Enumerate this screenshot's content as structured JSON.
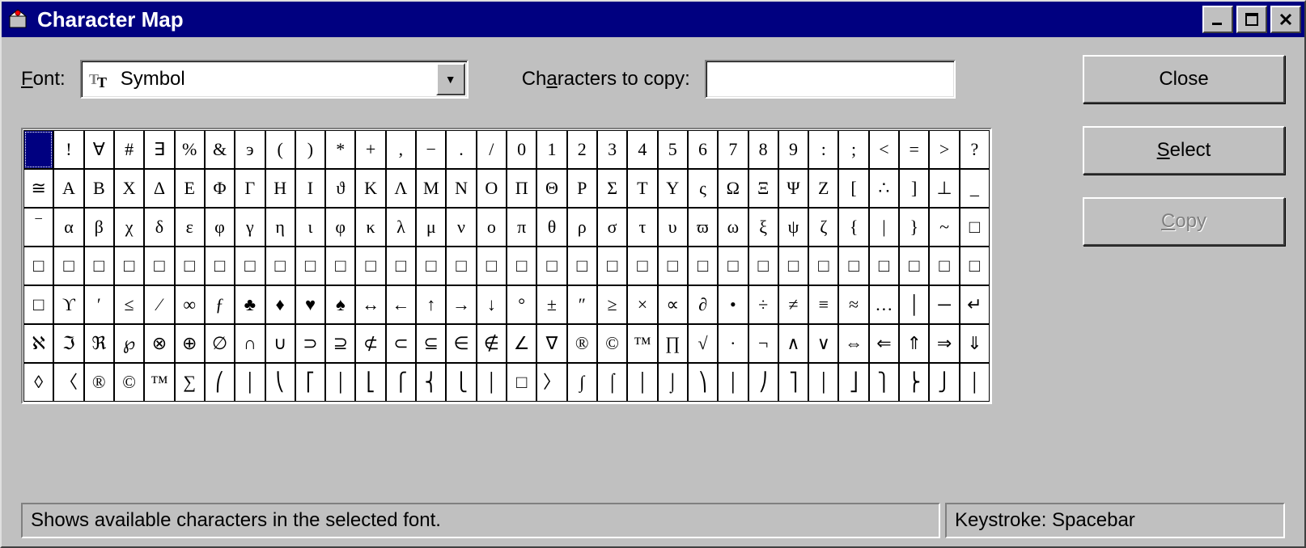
{
  "window": {
    "title": "Character Map"
  },
  "labels": {
    "font": "Font:",
    "chars_to_copy": "Characters to copy:"
  },
  "font_combo": {
    "value": "Symbol",
    "tt_glyph": "Tᴛ"
  },
  "copy_field": {
    "value": ""
  },
  "buttons": {
    "close": "Close",
    "select": "Select",
    "copy": "Copy"
  },
  "status": {
    "main": "Shows available characters in the selected font.",
    "keystroke": "Keystroke: Spacebar"
  },
  "grid": {
    "selected_index": 0,
    "rows": [
      [
        " ",
        "!",
        "∀",
        "#",
        "∃",
        "%",
        "&",
        "э",
        "(",
        ")",
        "*",
        "+",
        ",",
        "−",
        ".",
        "/",
        "0",
        "1",
        "2",
        "3",
        "4",
        "5",
        "6",
        "7",
        "8",
        "9",
        ":",
        ";",
        "<",
        "=",
        ">",
        "?"
      ],
      [
        "≅",
        "Α",
        "Β",
        "Χ",
        "Δ",
        "Ε",
        "Φ",
        "Γ",
        "Η",
        "Ι",
        "ϑ",
        "Κ",
        "Λ",
        "Μ",
        "Ν",
        "Ο",
        "Π",
        "Θ",
        "Ρ",
        "Σ",
        "Τ",
        "Υ",
        "ς",
        "Ω",
        "Ξ",
        "Ψ",
        "Ζ",
        "[",
        "∴",
        "]",
        "⊥",
        "_"
      ],
      [
        "‾",
        "α",
        "β",
        "χ",
        "δ",
        "ε",
        "φ",
        "γ",
        "η",
        "ι",
        "φ",
        "κ",
        "λ",
        "μ",
        "ν",
        "ο",
        "π",
        "θ",
        "ρ",
        "σ",
        "τ",
        "υ",
        "ϖ",
        "ω",
        "ξ",
        "ψ",
        "ζ",
        "{",
        "|",
        "}",
        "~",
        "□"
      ],
      [
        "□",
        "□",
        "□",
        "□",
        "□",
        "□",
        "□",
        "□",
        "□",
        "□",
        "□",
        "□",
        "□",
        "□",
        "□",
        "□",
        "□",
        "□",
        "□",
        "□",
        "□",
        "□",
        "□",
        "□",
        "□",
        "□",
        "□",
        "□",
        "□",
        "□",
        "□",
        "□"
      ],
      [
        "□",
        "ϒ",
        "′",
        "≤",
        "⁄",
        "∞",
        "ƒ",
        "♣",
        "♦",
        "♥",
        "♠",
        "↔",
        "←",
        "↑",
        "→",
        "↓",
        "°",
        "±",
        "″",
        "≥",
        "×",
        "∝",
        "∂",
        "•",
        "÷",
        "≠",
        "≡",
        "≈",
        "…",
        "│",
        "─",
        "↵"
      ],
      [
        "ℵ",
        "ℑ",
        "ℜ",
        "℘",
        "⊗",
        "⊕",
        "∅",
        "∩",
        "∪",
        "⊃",
        "⊇",
        "⊄",
        "⊂",
        "⊆",
        "∈",
        "∉",
        "∠",
        "∇",
        "®",
        "©",
        "™",
        "∏",
        "√",
        "·",
        "¬",
        "∧",
        "∨",
        "⇔",
        "⇐",
        "⇑",
        "⇒",
        "⇓"
      ],
      [
        "◊",
        "〈",
        "®",
        "©",
        "™",
        "∑",
        "⎛",
        "│",
        "⎝",
        "⎡",
        "│",
        "⎣",
        "⎧",
        "⎨",
        "⎩",
        "│",
        "□",
        "〉",
        "∫",
        "⌠",
        "│",
        "⌡",
        "⎞",
        "│",
        "⎠",
        "⎤",
        "│",
        "⎦",
        "⎫",
        "⎬",
        "⎭",
        "│"
      ]
    ]
  }
}
